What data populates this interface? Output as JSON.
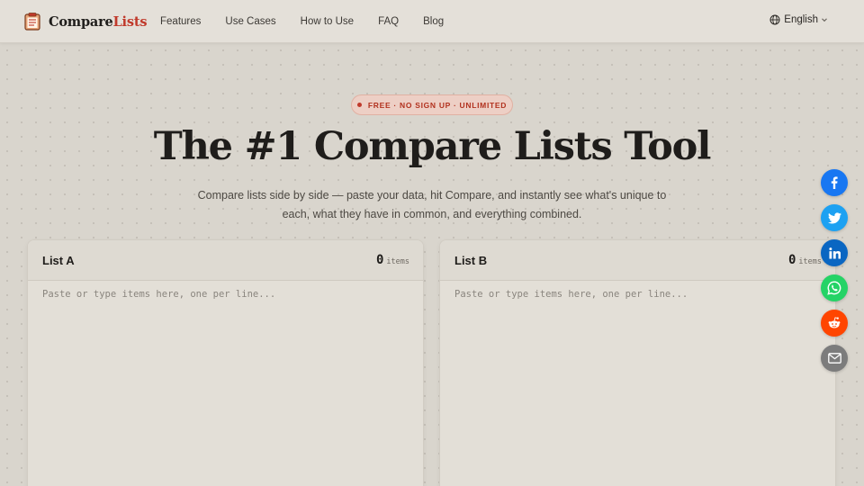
{
  "brand": {
    "name_primary": "Compare",
    "name_accent": "Lists"
  },
  "nav": {
    "items": [
      {
        "label": "Features"
      },
      {
        "label": "Use Cases"
      },
      {
        "label": "How to Use"
      },
      {
        "label": "FAQ"
      },
      {
        "label": "Blog"
      }
    ],
    "language": "English"
  },
  "hero": {
    "badge": "FREE · NO SIGN UP · UNLIMITED",
    "title": "The #1 Compare Lists Tool",
    "subtitle": "Compare lists side by side — paste your data, hit Compare, and instantly see what's unique to each, what they have in common, and everything combined."
  },
  "lists": [
    {
      "title": "List A",
      "count": "0",
      "count_label": "items",
      "placeholder": "Paste or type items here, one per line..."
    },
    {
      "title": "List B",
      "count": "0",
      "count_label": "items",
      "placeholder": "Paste or type items here, one per line..."
    }
  ],
  "share": [
    {
      "network": "facebook",
      "icon": "facebook-icon",
      "color": "#1877f2"
    },
    {
      "network": "twitter",
      "icon": "twitter-icon",
      "color": "#1da1f2"
    },
    {
      "network": "linkedin",
      "icon": "linkedin-icon",
      "color": "#0a66c2"
    },
    {
      "network": "whatsapp",
      "icon": "whatsapp-icon",
      "color": "#25d366"
    },
    {
      "network": "reddit",
      "icon": "reddit-icon",
      "color": "#ff4500"
    },
    {
      "network": "email",
      "icon": "email-icon",
      "color": "#7c7c7c"
    }
  ],
  "colors": {
    "accent": "#c0392b",
    "background": "#d9d5cd",
    "panel": "#e3dfd7"
  }
}
